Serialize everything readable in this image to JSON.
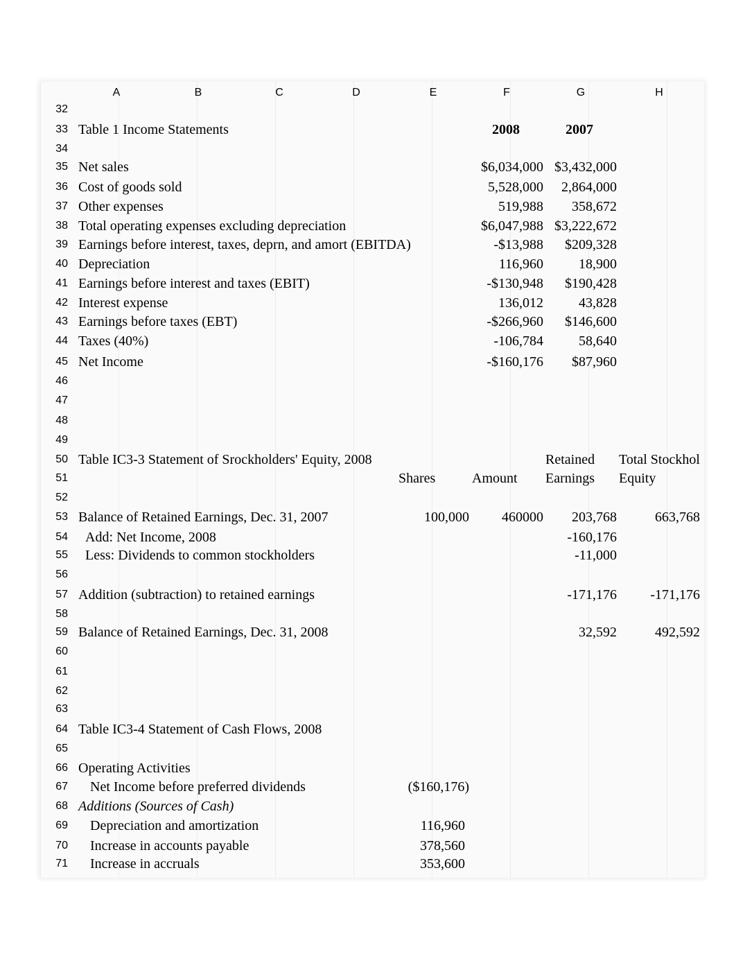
{
  "columns": [
    "A",
    "B",
    "C",
    "D",
    "E",
    "F",
    "G",
    "H"
  ],
  "rows": [
    {
      "num": "32"
    },
    {
      "num": "33",
      "label": "Table 1 Income Statements",
      "f": "2008",
      "g": "2007",
      "header_bold": true
    },
    {
      "num": "34"
    },
    {
      "num": "35",
      "label": "Net sales",
      "f": "$6,034,000",
      "g": "$3,432,000"
    },
    {
      "num": "36",
      "label": "Cost of goods sold",
      "f": "5,528,000",
      "g": "2,864,000"
    },
    {
      "num": "37",
      "label": "Other expenses",
      "f": "519,988",
      "g": "358,672"
    },
    {
      "num": "38",
      "label": "Total operating expenses excluding depreciation",
      "f": "$6,047,988",
      "g": "$3,222,672"
    },
    {
      "num": "39",
      "label": "Earnings before interest, taxes, deprn, and amort (EBITDA)",
      "f": "-$13,988",
      "g": "$209,328"
    },
    {
      "num": "40",
      "label": "Depreciation",
      "f": "116,960",
      "g": "18,900"
    },
    {
      "num": "41",
      "label": "Earnings before interest and taxes (EBIT)",
      "f": "-$130,948",
      "g": "$190,428"
    },
    {
      "num": "42",
      "label": "Interest expense",
      "f": "136,012",
      "g": "43,828"
    },
    {
      "num": "43",
      "label": "Earnings before taxes (EBT)",
      "f": "-$266,960",
      "g": "$146,600"
    },
    {
      "num": "44",
      "label": "Taxes (40%)",
      "f": "-106,784",
      "g": "58,640"
    },
    {
      "num": "45",
      "label": "Net Income",
      "f": "-$160,176",
      "g": "$87,960"
    },
    {
      "num": "46"
    },
    {
      "num": "47"
    },
    {
      "num": "48"
    },
    {
      "num": "49"
    },
    {
      "num": "50",
      "label": "Table IC3-3   Statement of Srockholders' Equity, 2008",
      "g": "Retained",
      "h": "Total Stockhol",
      "left_headers": true
    },
    {
      "num": "51",
      "e": "Shares",
      "f": "Amount",
      "g": "Earnings",
      "h": "Equity",
      "left_headers": true
    },
    {
      "num": "52"
    },
    {
      "num": "53",
      "label": "Balance of Retained Earnings, Dec. 31, 2007",
      "e": "100,000",
      "f": "460000",
      "g": "203,768",
      "h": "663,768"
    },
    {
      "num": "54",
      "label": "Add:  Net Income, 2008",
      "indent": 1,
      "g": "-160,176"
    },
    {
      "num": "55",
      "label": "Less: Dividends to common stockholders",
      "indent": 1,
      "g": "-11,000"
    },
    {
      "num": "56"
    },
    {
      "num": "57",
      "label": "Addition (subtraction) to retained earnings",
      "g": "-171,176",
      "h": "-171,176"
    },
    {
      "num": "58"
    },
    {
      "num": "59",
      "label": "Balance of Retained Earnings, Dec. 31, 2008",
      "g": "32,592",
      "h": "492,592"
    },
    {
      "num": "60"
    },
    {
      "num": "61"
    },
    {
      "num": "62"
    },
    {
      "num": "63"
    },
    {
      "num": "64",
      "label": "Table IC3-4   Statement of Cash Flows, 2008"
    },
    {
      "num": "65"
    },
    {
      "num": "66",
      "label": "Operating Activities"
    },
    {
      "num": "67",
      "label": "Net Income before preferred dividends",
      "indent": 2,
      "e": "($160,176)"
    },
    {
      "num": "68",
      "label": "Additions (Sources of Cash)",
      "italic": true
    },
    {
      "num": "69",
      "label": "Depreciation and amortization",
      "indent": 2,
      "e": "116,960",
      "paren_pad": true
    },
    {
      "num": "70",
      "label": "Increase in accounts payable",
      "indent": 2,
      "e": "378,560",
      "paren_pad": true
    },
    {
      "num": "71",
      "label": "Increase in accruals",
      "indent": 2,
      "e": "353,600",
      "paren_pad": true
    }
  ]
}
